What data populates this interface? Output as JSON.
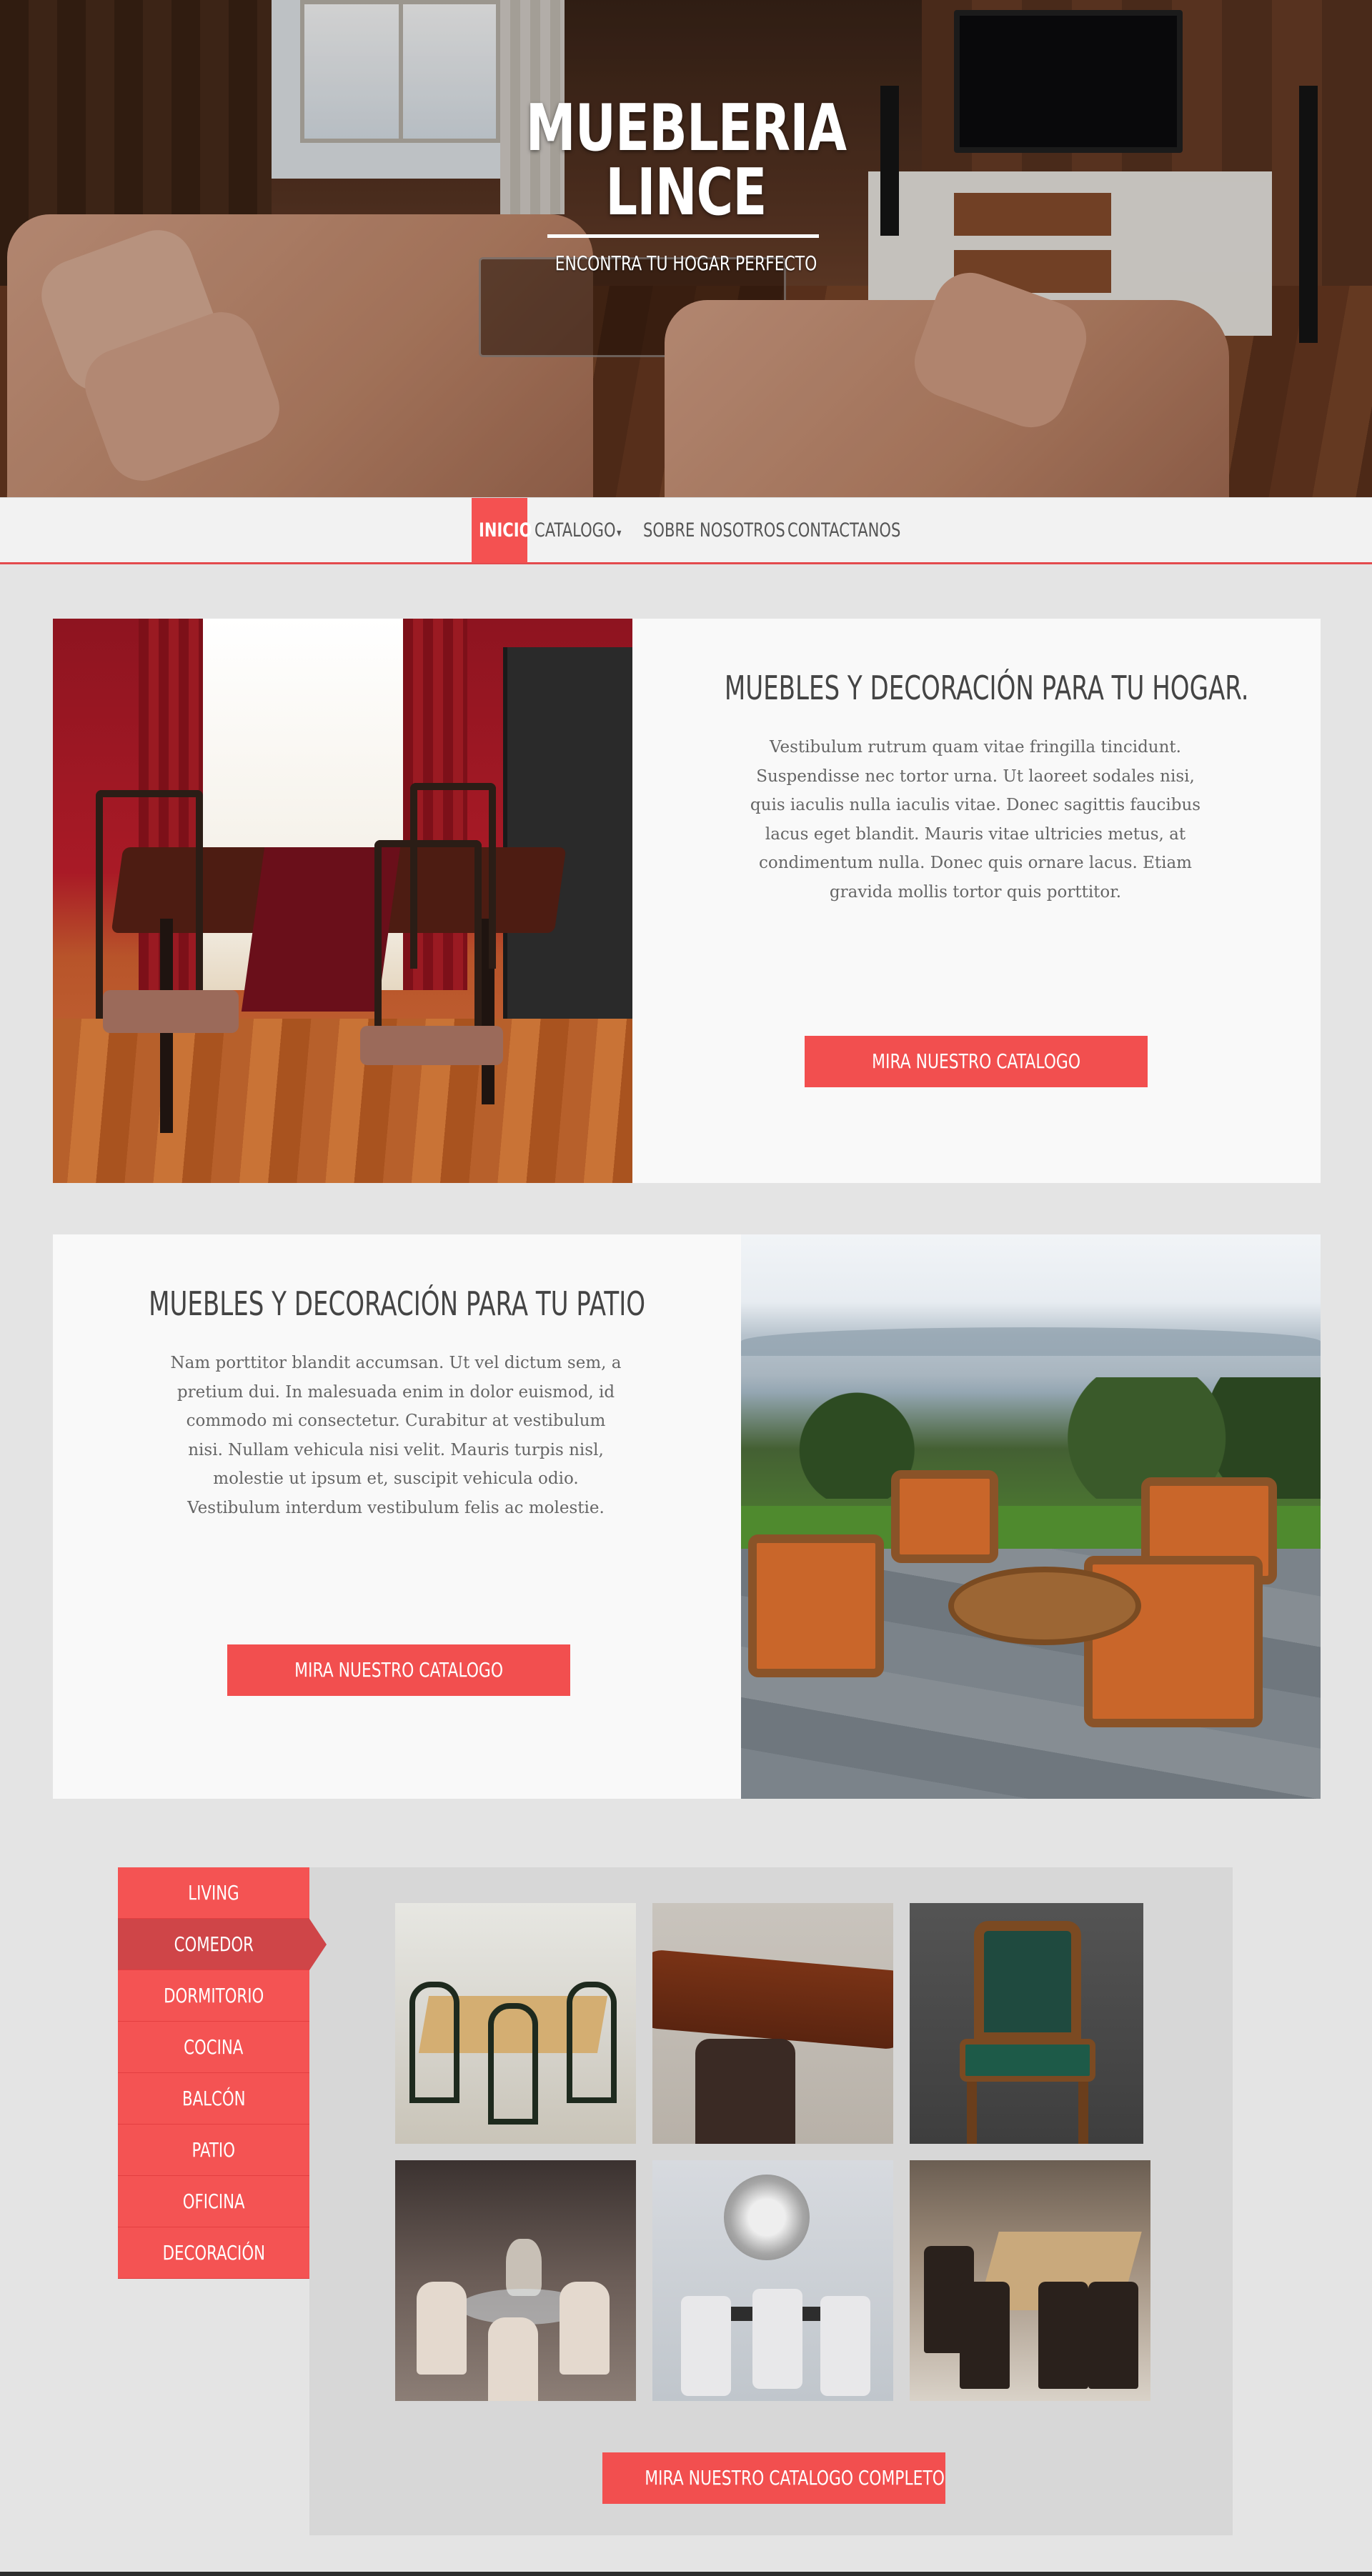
{
  "hero": {
    "title_line1": "MUEBLERIA",
    "title_line2": "LINCE",
    "tagline": "ENCONTRA TU HOGAR PERFECTO"
  },
  "nav": {
    "items": [
      {
        "label": "INICIO",
        "active": true
      },
      {
        "label": "CATALOGO",
        "has_dropdown": true
      },
      {
        "label": "SOBRE NOSOTROS"
      },
      {
        "label": "CONTACTANOS"
      }
    ],
    "caret": "▾"
  },
  "feature1": {
    "title": "MUEBLES Y DECORACIÓN PARA TU HOGAR.",
    "body": "Vestibulum rutrum quam vitae fringilla tincidunt. Suspendisse nec tortor urna. Ut laoreet sodales nisi, quis iaculis nulla iaculis vitae. Donec sagittis faucibus lacus eget blandit. Mauris vitae ultricies metus, at condimentum nulla. Donec quis ornare lacus. Etiam gravida mollis tortor quis porttitor.",
    "button": "MIRA NUESTRO CATALOGO"
  },
  "feature2": {
    "title": "MUEBLES Y DECORACIÓN PARA TU PATIO",
    "body": "Nam porttitor blandit accumsan. Ut vel dictum sem, a pretium dui. In malesuada enim in dolor euismod, id commodo mi consectetur. Curabitur at vestibulum nisi. Nullam vehicula nisi velit. Mauris turpis nisl, molestie ut ipsum et, suscipit vehicula odio. Vestibulum interdum vestibulum felis ac molestie.",
    "button": "MIRA NUESTRO CATALOGO"
  },
  "catalog": {
    "categories": [
      {
        "label": "LIVING"
      },
      {
        "label": "COMEDOR",
        "active": true
      },
      {
        "label": "DORMITORIO"
      },
      {
        "label": "COCINA"
      },
      {
        "label": "BALCÓN"
      },
      {
        "label": "PATIO"
      },
      {
        "label": "OFICINA"
      },
      {
        "label": "DECORACIÓN"
      }
    ],
    "button": "MIRA NUESTRO CATALOGO COMPLETO"
  },
  "colors": {
    "accent": "#f45151",
    "accent_dark": "#cf4548",
    "background": "#e4e4e4",
    "panel": "#f9f9f9"
  }
}
